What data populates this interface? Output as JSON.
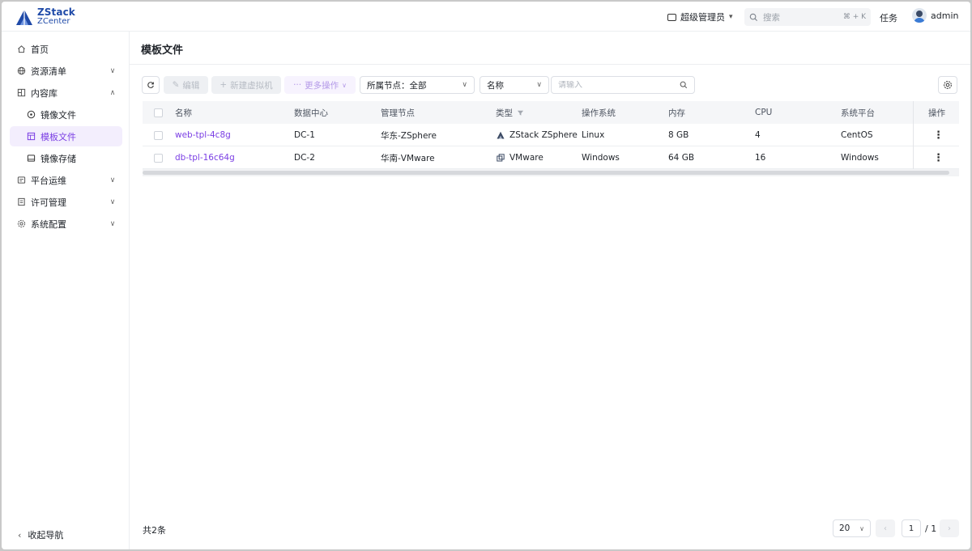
{
  "brand": {
    "line1": "ZStack",
    "line2": "ZCenter"
  },
  "header": {
    "role": "超级管理员",
    "search_placeholder": "搜索",
    "search_shortcut": "⌘ + K",
    "tasks": "任务",
    "user": "admin"
  },
  "sidebar": {
    "items": [
      {
        "label": "首页"
      },
      {
        "label": "资源清单"
      },
      {
        "label": "内容库"
      },
      {
        "label": "镜像文件"
      },
      {
        "label": "模板文件"
      },
      {
        "label": "镜像存储"
      },
      {
        "label": "平台运维"
      },
      {
        "label": "许可管理"
      },
      {
        "label": "系统配置"
      }
    ],
    "collapse_label": "收起导航"
  },
  "page": {
    "title": "模板文件"
  },
  "toolbar": {
    "edit": "编辑",
    "new_vm": "新建虚拟机",
    "more": "更多操作",
    "node_filter": "所属节点：全部",
    "field_select": "名称",
    "keyword_placeholder": "请输入"
  },
  "table": {
    "columns": [
      "名称",
      "数据中心",
      "管理节点",
      "类型",
      "操作系统",
      "内存",
      "CPU",
      "系统平台",
      "操作"
    ],
    "rows": [
      {
        "name": "web-tpl-4c8g",
        "dc": "DC-1",
        "node": "华东-ZSphere",
        "type": "ZStack ZSphere",
        "os": "Linux",
        "memory": "8 GB",
        "cpu": "4",
        "platform": "CentOS"
      },
      {
        "name": "db-tpl-16c64g",
        "dc": "DC-2",
        "node": "华南-VMware",
        "type": "VMware",
        "os": "Windows",
        "memory": "64 GB",
        "cpu": "16",
        "platform": "Windows"
      }
    ]
  },
  "footer": {
    "total": "共2条",
    "page_size": "20",
    "current_page": "1",
    "total_pages": "/ 1"
  },
  "colors": {
    "accent": "#7b3fe4",
    "brand": "#1f4aa8"
  }
}
